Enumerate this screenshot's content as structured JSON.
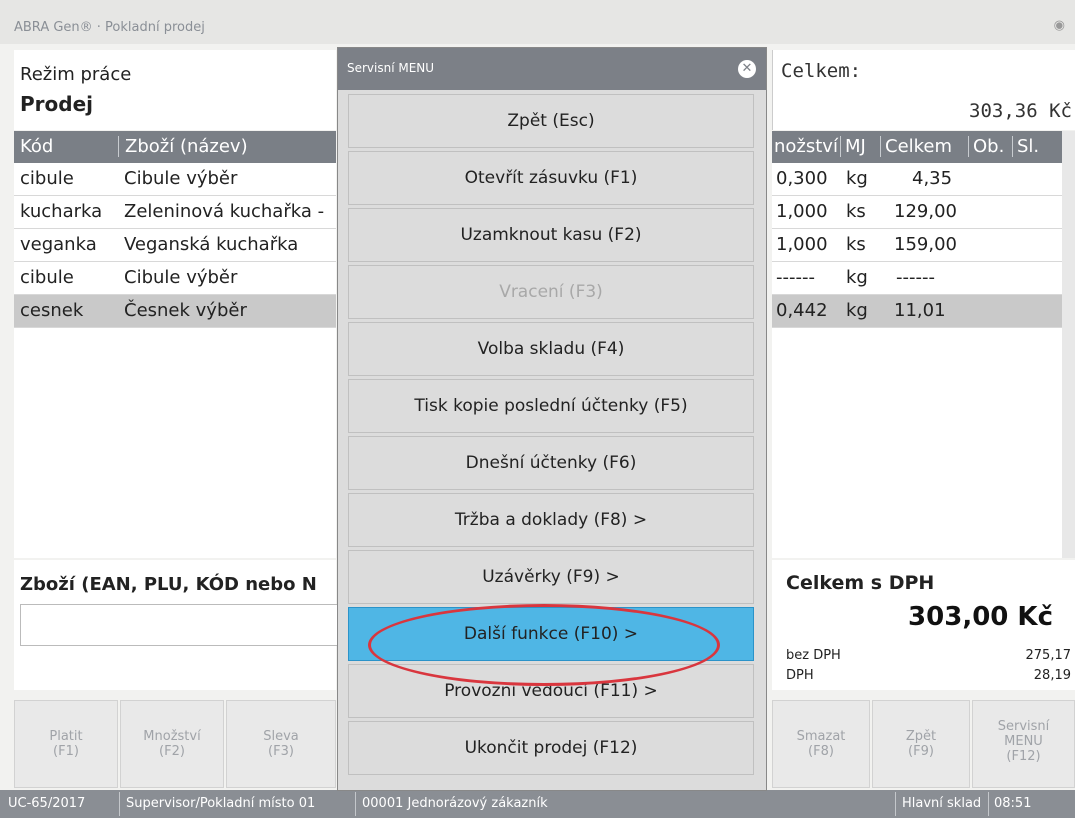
{
  "window": {
    "title": "ABRA Gen® · Pokladní prodej"
  },
  "mode": {
    "label": "Režim práce",
    "value": "Prodej"
  },
  "total_top": {
    "label": "Celkem:",
    "value": "303,36 Kč"
  },
  "table": {
    "headers": [
      "Kód",
      "Zboží (název)",
      "nožství",
      "MJ",
      "Celkem",
      "Ob.",
      "Sl."
    ],
    "rows": [
      {
        "kod": "cibule",
        "nazev": "Cibule výběr",
        "mnozstvi": "0,300",
        "mj": "kg",
        "celkem": "4,35"
      },
      {
        "kod": "kucharka",
        "nazev": "Zeleninová kuchařka -",
        "mnozstvi": "1,000",
        "mj": "ks",
        "celkem": "129,00"
      },
      {
        "kod": "veganka",
        "nazev": "Veganská kuchařka",
        "mnozstvi": "1,000",
        "mj": "ks",
        "celkem": "159,00"
      },
      {
        "kod": "cibule",
        "nazev": "Cibule výběr",
        "mnozstvi": "------",
        "mj": "kg",
        "celkem": "------"
      },
      {
        "kod": "cesnek",
        "nazev": "Česnek výběr",
        "mnozstvi": "0,442",
        "mj": "kg",
        "celkem": "11,01"
      }
    ]
  },
  "search": {
    "heading": "Zboží (EAN, PLU, KÓD nebo N"
  },
  "totals": {
    "heading": "Celkem s DPH",
    "amount": "303,00 Kč",
    "bez_dph_label": "bez DPH",
    "bez_dph_value": "275,17",
    "dph_label": "DPH",
    "dph_value": "28,19"
  },
  "function_buttons": [
    {
      "line1": "Platit",
      "line2": "(F1)"
    },
    {
      "line1": "Množství",
      "line2": "(F2)"
    },
    {
      "line1": "Sleva",
      "line2": "(F3)"
    },
    {
      "line1": "Smazat",
      "line2": "(F8)"
    },
    {
      "line1": "Zpět",
      "line2": "(F9)"
    },
    {
      "line1": "Servisní",
      "line2": "MENU",
      "line3": "(F12)"
    }
  ],
  "status": {
    "doc": "UC-65/2017",
    "user": "Supervisor/Pokladní místo 01",
    "customer": "00001 Jednorázový zákazník",
    "store": "Hlavní sklad",
    "time": "08:51"
  },
  "modal": {
    "title": "Servisní MENU",
    "items": [
      {
        "label": "Zpět (Esc)"
      },
      {
        "label": "Otevřít zásuvku (F1)"
      },
      {
        "label": "Uzamknout kasu (F2)"
      },
      {
        "label": "Vracení (F3)",
        "disabled": true
      },
      {
        "label": "Volba skladu (F4)"
      },
      {
        "label": "Tisk kopie poslední účtenky (F5)"
      },
      {
        "label": "Dnešní účtenky (F6)"
      },
      {
        "label": "Tržba a doklady  (F8) >"
      },
      {
        "label": "Uzávěrky  (F9) >"
      },
      {
        "label": "Další funkce  (F10) >",
        "active": true
      },
      {
        "label": "Provozní vedoucí  (F11) >"
      },
      {
        "label": "Ukončit prodej (F12)"
      }
    ]
  },
  "colors": {
    "highlight": "#4fb6e5",
    "annotation_circle": "#d9363e",
    "header_bg": "#7a7f86"
  }
}
